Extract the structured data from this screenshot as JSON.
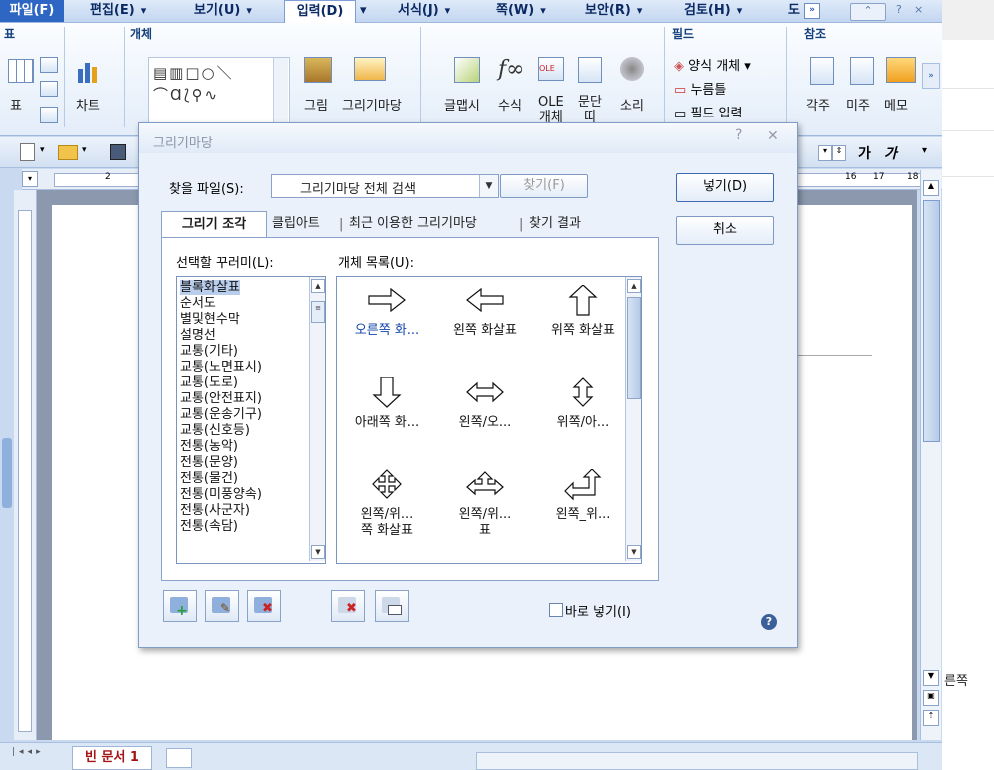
{
  "menu": {
    "file": "파일(F)",
    "edit": "편집(E)",
    "view": "보기(U)",
    "input": "입력(D)",
    "format": "서식(J)",
    "page": "쪽(W)",
    "security": "보안(R)",
    "review": "검토(H)",
    "tools": "도"
  },
  "ribbon": {
    "groups": {
      "table": "표",
      "object": "개체",
      "field": "필드",
      "reference": "참조"
    },
    "buttons": {
      "table": "표",
      "chart": "차트",
      "picture": "그림",
      "gallery": "그리기마당",
      "glyph": "글맵시",
      "formula": "수식",
      "ole": "OLE",
      "ole2": "개체",
      "paragraph": "문단",
      "paragraph2": "띠",
      "sound": "소리",
      "form_object": "양식 개체",
      "click_here": "누름틀",
      "field_input": "필드 입력",
      "footnote": "각주",
      "endnote": "미주",
      "memo": "메모"
    }
  },
  "toolbar": {
    "font_bold_sample": "가",
    "font_italic_sample": "가"
  },
  "ruler": {
    "marks": [
      "2",
      "16",
      "17",
      "18"
    ]
  },
  "document": {
    "tab_name": "빈 문서 1"
  },
  "outside_text": "른쪽",
  "dialog": {
    "title": "그리기마당",
    "find_label": "찾을 파일(S):",
    "find_value": "그리기마당 전체 검색",
    "search_button": "찾기(F)",
    "insert_button": "넣기(D)",
    "cancel_button": "취소",
    "tabs": [
      "그리기 조각",
      "클립아트",
      "최근 이용한 그리기마당",
      "찾기 결과"
    ],
    "deco_label": "선택할 꾸러미(L):",
    "objects_label": "개체 목록(U):",
    "deco_items": [
      "블록화살표",
      "순서도",
      "별및현수막",
      "설명선",
      "교통(기타)",
      "교통(노면표시)",
      "교통(도로)",
      "교통(안전표지)",
      "교통(운송기구)",
      "교통(신호등)",
      "전통(농악)",
      "전통(문양)",
      "전통(물건)",
      "전통(미풍양속)",
      "전통(사군자)",
      "전통(속담)"
    ],
    "objects": [
      {
        "name": "오른쪽 화...",
        "icon": "right-arrow-icon"
      },
      {
        "name": "왼쪽 화살표",
        "icon": "left-arrow-icon"
      },
      {
        "name": "위쪽 화살표",
        "icon": "up-arrow-icon"
      },
      {
        "name": "아래쪽 화...",
        "icon": "down-arrow-icon"
      },
      {
        "name": "왼쪽/오...",
        "icon": "left-right-arrow-icon"
      },
      {
        "name": "위쪽/아...",
        "icon": "up-down-arrow-icon"
      },
      {
        "name": "왼쪽/위...",
        "name2": "쪽 화살표",
        "icon": "quad-arrow-icon"
      },
      {
        "name": "왼쪽/위...",
        "name2": "표",
        "icon": "left-right-up-arrow-icon"
      },
      {
        "name": "왼쪽_위...",
        "icon": "left-up-arrow-icon"
      }
    ],
    "direct_insert_label": "바로 넣기(I)",
    "help": "?"
  }
}
